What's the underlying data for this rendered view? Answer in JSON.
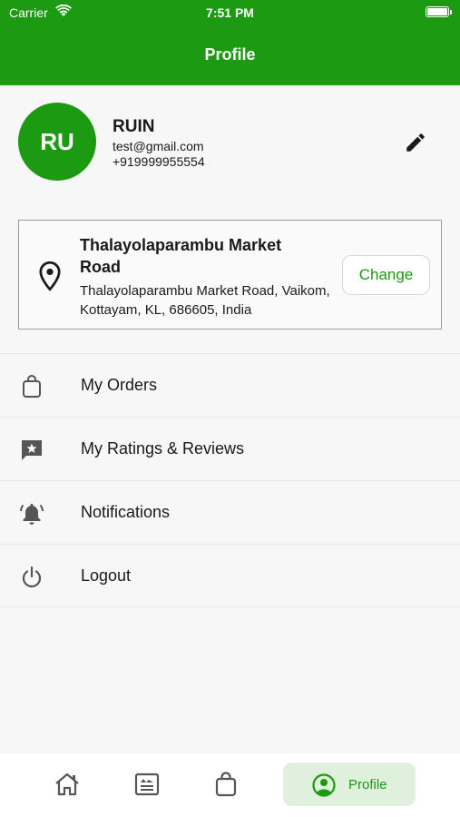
{
  "status_bar": {
    "carrier": "Carrier",
    "time": "7:51 PM"
  },
  "header": {
    "title": "Profile"
  },
  "profile": {
    "initials": "RU",
    "name": "RUIN",
    "email": "test@gmail.com",
    "phone": "+919999955554"
  },
  "address": {
    "title": "Thalayolaparambu Market Road",
    "text": "Thalayolaparambu Market Road, Vaikom, Kottayam, KL, 686605, India",
    "change_label": "Change"
  },
  "menu": [
    {
      "label": "My Orders",
      "icon": "bag-icon"
    },
    {
      "label": "My Ratings & Reviews",
      "icon": "review-icon"
    },
    {
      "label": "Notifications",
      "icon": "bell-icon"
    },
    {
      "label": "Logout",
      "icon": "power-icon"
    }
  ],
  "bottom_nav": {
    "items": [
      {
        "icon": "home-icon"
      },
      {
        "icon": "news-icon"
      },
      {
        "icon": "bag-icon"
      },
      {
        "icon": "profile-icon",
        "label": "Profile",
        "active": true
      }
    ]
  },
  "colors": {
    "brand": "#1b9a12",
    "active_bg": "#dff0dc"
  }
}
